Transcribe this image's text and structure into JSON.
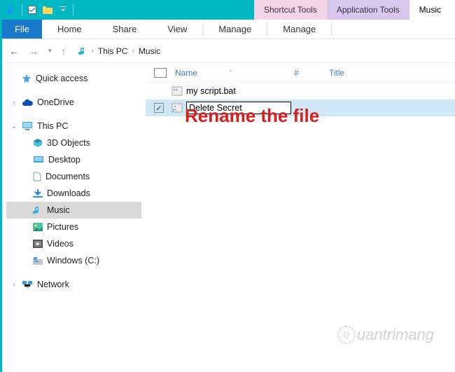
{
  "titlebar": {
    "context_tabs": {
      "shortcut": "Shortcut Tools",
      "application": "Application Tools"
    },
    "window_title": "Music"
  },
  "ribbon": {
    "file": "File",
    "tabs": [
      "Home",
      "Share",
      "View",
      "Manage",
      "Manage"
    ]
  },
  "breadcrumb": {
    "items": [
      "This PC",
      "Music"
    ]
  },
  "sidebar": {
    "quick_access": "Quick access",
    "onedrive": "OneDrive",
    "this_pc": "This PC",
    "children": [
      "3D Objects",
      "Desktop",
      "Documents",
      "Downloads",
      "Music",
      "Pictures",
      "Videos",
      "Windows (C:)"
    ],
    "network": "Network"
  },
  "columns": {
    "name": "Name",
    "hash": "#",
    "title": "Title"
  },
  "files": [
    {
      "name": "my script.bat",
      "selected": false
    },
    {
      "name": "Delete Secret",
      "selected": true,
      "renaming": true
    }
  ],
  "annotation": "Rename the file",
  "watermark": "uantrimang"
}
